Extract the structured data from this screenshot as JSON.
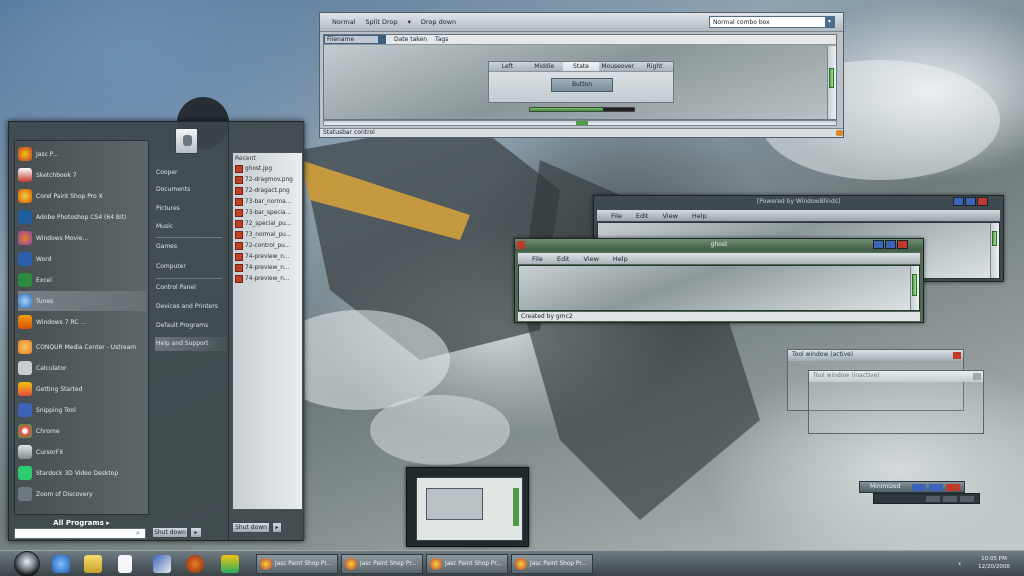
{
  "demo": {
    "toolbar": [
      "Normal",
      "Split Drop",
      "▾",
      "Drop down"
    ],
    "combo": "Normal combo box",
    "columns": [
      "Filename",
      "Date taken",
      "Tags"
    ],
    "tabs": [
      "Left",
      "Middle",
      "State",
      "Mouseover",
      "Right"
    ],
    "button": "Button",
    "progress": 0.7,
    "status": "Statusbar control"
  },
  "start": {
    "programs": [
      "Jasc P...",
      "Sketchbook 7",
      "Corel Paint Shop Pro X",
      "Adobe Photoshop CS4 (64 Bit)",
      "Windows Movie...",
      "Word",
      "Excel",
      "Tunes",
      "Windows 7 RC ...",
      "CONQUR Media Center - Ustream",
      "Calculator",
      "Getting Started",
      "Snipping Tool",
      "Chrome",
      "CursorFX",
      "Stardock 3D Video Desktop",
      "Zoom of Discovery"
    ],
    "all_programs": "All Programs",
    "places": [
      "Cooper",
      "Documents",
      "Pictures",
      "Music",
      "Games",
      "Computer",
      "Control Panel",
      "Devices and Printers",
      "Default Programs",
      "Help and Support"
    ],
    "shutdown": "Shut down",
    "recent_header": "Recent",
    "recent": [
      "ghost.jpg",
      "72-dragmov.png",
      "72-dragact.png",
      "73-bar_norma...",
      "73-bar_specia...",
      "72_special_pu...",
      "73_normal_pu...",
      "72-control_pu...",
      "74-preview_n...",
      "74-preview_n...",
      "74-preview_n..."
    ],
    "recent_shutdown": "Shut down"
  },
  "ww_window": {
    "title": "[Powered by WindowBlinds]",
    "menu": [
      "File",
      "Edit",
      "View",
      "Help"
    ]
  },
  "ghost_window": {
    "title": "ghost",
    "menu": [
      "File",
      "Edit",
      "View",
      "Help"
    ],
    "status": "Created by gmc2"
  },
  "tool1": {
    "title": "Tool window (active)"
  },
  "tool2": {
    "title": "Tool window (inactive)"
  },
  "minbar": {
    "label": "Minimized"
  },
  "taskbar": {
    "tasks": [
      "Jasc Paint Shop Pr...",
      "Jasc Paint Shop Pr...",
      "Jasc Paint Shop Pr...",
      "Jasc Paint Shop Pr..."
    ],
    "clock_time": "10:05 PM",
    "clock_date": "12/20/2008"
  },
  "colors": {
    "accent_green": "#4f9b48",
    "close_red": "#c0392b",
    "caption_blue": "#3d63b8"
  }
}
